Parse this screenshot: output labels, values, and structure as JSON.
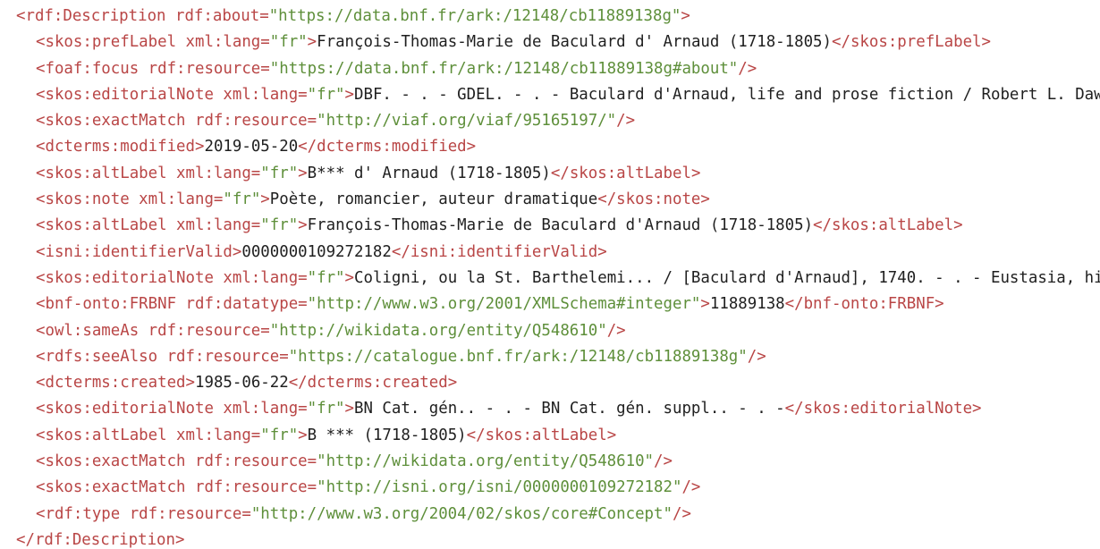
{
  "colors": {
    "tag": "#b94646",
    "string": "#5e8f3a",
    "text": "#1f1f1f",
    "background": "#ffffff"
  },
  "lines": [
    {
      "indent": 0,
      "parts": [
        {
          "k": "tag",
          "t": "<rdf:Description rdf:about="
        },
        {
          "k": "str",
          "t": "\"https://data.bnf.fr/ark:/12148/cb11889138g\""
        },
        {
          "k": "tag",
          "t": ">"
        }
      ]
    },
    {
      "indent": 1,
      "parts": [
        {
          "k": "tag",
          "t": "<skos:prefLabel xml:lang="
        },
        {
          "k": "str",
          "t": "\"fr\""
        },
        {
          "k": "tag",
          "t": ">"
        },
        {
          "k": "txt",
          "t": "François-Thomas-Marie de Baculard d' Arnaud (1718-1805)"
        },
        {
          "k": "tag",
          "t": "</skos:prefLabel>"
        }
      ]
    },
    {
      "indent": 1,
      "parts": [
        {
          "k": "tag",
          "t": "<foaf:focus rdf:resource="
        },
        {
          "k": "str",
          "t": "\"https://data.bnf.fr/ark:/12148/cb11889138g#about\""
        },
        {
          "k": "tag",
          "t": "/>"
        }
      ]
    },
    {
      "indent": 1,
      "parts": [
        {
          "k": "tag",
          "t": "<skos:editorialNote xml:lang="
        },
        {
          "k": "str",
          "t": "\"fr\""
        },
        {
          "k": "tag",
          "t": ">"
        },
        {
          "k": "txt",
          "t": "DBF. - . - GDEL. - . - Baculard d'Arnaud, life and prose fiction / Robert L. Dawson"
        }
      ]
    },
    {
      "indent": 1,
      "parts": [
        {
          "k": "tag",
          "t": "<skos:exactMatch rdf:resource="
        },
        {
          "k": "str",
          "t": "\"http://viaf.org/viaf/95165197/\""
        },
        {
          "k": "tag",
          "t": "/>"
        }
      ]
    },
    {
      "indent": 1,
      "parts": [
        {
          "k": "tag",
          "t": "<dcterms:modified>"
        },
        {
          "k": "txt",
          "t": "2019-05-20"
        },
        {
          "k": "tag",
          "t": "</dcterms:modified>"
        }
      ]
    },
    {
      "indent": 1,
      "parts": [
        {
          "k": "tag",
          "t": "<skos:altLabel xml:lang="
        },
        {
          "k": "str",
          "t": "\"fr\""
        },
        {
          "k": "tag",
          "t": ">"
        },
        {
          "k": "txt",
          "t": "B*** d' Arnaud (1718-1805)"
        },
        {
          "k": "tag",
          "t": "</skos:altLabel>"
        }
      ]
    },
    {
      "indent": 1,
      "parts": [
        {
          "k": "tag",
          "t": "<skos:note xml:lang="
        },
        {
          "k": "str",
          "t": "\"fr\""
        },
        {
          "k": "tag",
          "t": ">"
        },
        {
          "k": "txt",
          "t": "Poète, romancier, auteur dramatique"
        },
        {
          "k": "tag",
          "t": "</skos:note>"
        }
      ]
    },
    {
      "indent": 1,
      "parts": [
        {
          "k": "tag",
          "t": "<skos:altLabel xml:lang="
        },
        {
          "k": "str",
          "t": "\"fr\""
        },
        {
          "k": "tag",
          "t": ">"
        },
        {
          "k": "txt",
          "t": "François-Thomas-Marie de Baculard d'Arnaud (1718-1805)"
        },
        {
          "k": "tag",
          "t": "</skos:altLabel>"
        }
      ]
    },
    {
      "indent": 1,
      "parts": [
        {
          "k": "tag",
          "t": "<isni:identifierValid>"
        },
        {
          "k": "txt",
          "t": "0000000109272182"
        },
        {
          "k": "tag",
          "t": "</isni:identifierValid>"
        }
      ]
    },
    {
      "indent": 1,
      "parts": [
        {
          "k": "tag",
          "t": "<skos:editorialNote xml:lang="
        },
        {
          "k": "str",
          "t": "\"fr\""
        },
        {
          "k": "tag",
          "t": ">"
        },
        {
          "k": "txt",
          "t": "Coligni, ou la St. Barthelemi... / [Baculard d'Arnaud], 1740. - . - Eustasia, hi"
        }
      ]
    },
    {
      "indent": 1,
      "parts": [
        {
          "k": "tag",
          "t": "<bnf-onto:FRBNF rdf:datatype="
        },
        {
          "k": "str",
          "t": "\"http://www.w3.org/2001/XMLSchema#integer\""
        },
        {
          "k": "tag",
          "t": ">"
        },
        {
          "k": "txt",
          "t": "11889138"
        },
        {
          "k": "tag",
          "t": "</bnf-onto:FRBNF>"
        }
      ]
    },
    {
      "indent": 1,
      "parts": [
        {
          "k": "tag",
          "t": "<owl:sameAs rdf:resource="
        },
        {
          "k": "str",
          "t": "\"http://wikidata.org/entity/Q548610\""
        },
        {
          "k": "tag",
          "t": "/>"
        }
      ]
    },
    {
      "indent": 1,
      "parts": [
        {
          "k": "tag",
          "t": "<rdfs:seeAlso rdf:resource="
        },
        {
          "k": "str",
          "t": "\"https://catalogue.bnf.fr/ark:/12148/cb11889138g\""
        },
        {
          "k": "tag",
          "t": "/>"
        }
      ]
    },
    {
      "indent": 1,
      "parts": [
        {
          "k": "tag",
          "t": "<dcterms:created>"
        },
        {
          "k": "txt",
          "t": "1985-06-22"
        },
        {
          "k": "tag",
          "t": "</dcterms:created>"
        }
      ]
    },
    {
      "indent": 1,
      "parts": [
        {
          "k": "tag",
          "t": "<skos:editorialNote xml:lang="
        },
        {
          "k": "str",
          "t": "\"fr\""
        },
        {
          "k": "tag",
          "t": ">"
        },
        {
          "k": "txt",
          "t": "BN Cat. gén.. - . - BN Cat. gén. suppl.. - . -"
        },
        {
          "k": "tag",
          "t": "</skos:editorialNote>"
        }
      ]
    },
    {
      "indent": 1,
      "parts": [
        {
          "k": "tag",
          "t": "<skos:altLabel xml:lang="
        },
        {
          "k": "str",
          "t": "\"fr\""
        },
        {
          "k": "tag",
          "t": ">"
        },
        {
          "k": "txt",
          "t": "B *** (1718-1805)"
        },
        {
          "k": "tag",
          "t": "</skos:altLabel>"
        }
      ]
    },
    {
      "indent": 1,
      "parts": [
        {
          "k": "tag",
          "t": "<skos:exactMatch rdf:resource="
        },
        {
          "k": "str",
          "t": "\"http://wikidata.org/entity/Q548610\""
        },
        {
          "k": "tag",
          "t": "/>"
        }
      ]
    },
    {
      "indent": 1,
      "parts": [
        {
          "k": "tag",
          "t": "<skos:exactMatch rdf:resource="
        },
        {
          "k": "str",
          "t": "\"http://isni.org/isni/0000000109272182\""
        },
        {
          "k": "tag",
          "t": "/>"
        }
      ]
    },
    {
      "indent": 1,
      "parts": [
        {
          "k": "tag",
          "t": "<rdf:type rdf:resource="
        },
        {
          "k": "str",
          "t": "\"http://www.w3.org/2004/02/skos/core#Concept\""
        },
        {
          "k": "tag",
          "t": "/>"
        }
      ]
    },
    {
      "indent": 0,
      "parts": [
        {
          "k": "tag",
          "t": "</rdf:Description>"
        }
      ]
    }
  ]
}
